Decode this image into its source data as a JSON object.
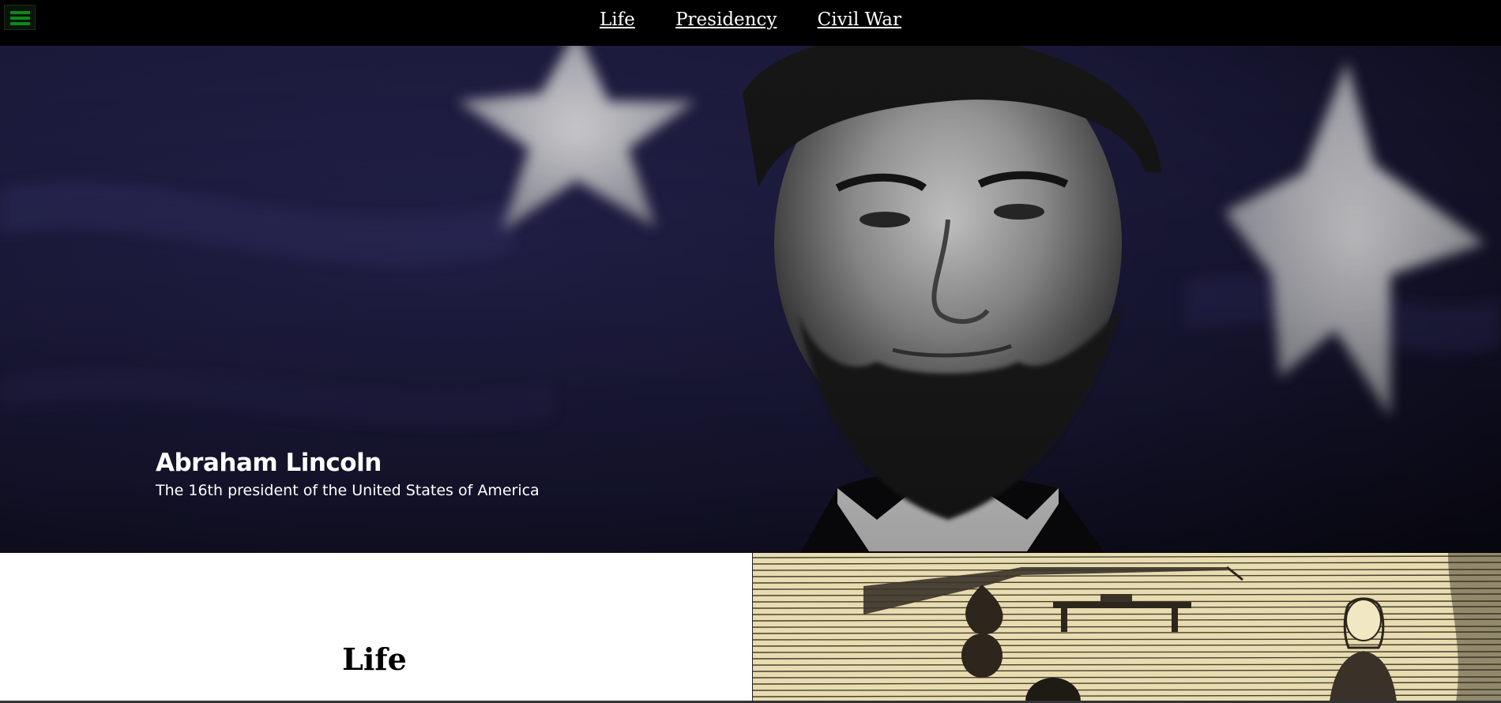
{
  "menu": {
    "icon": "hamburger-menu-icon"
  },
  "nav": {
    "items": [
      "Life",
      "Presidency",
      "Civil War"
    ]
  },
  "hero": {
    "title": "Abraham Lincoln",
    "subtitle": "The 16th president of the United States of America",
    "image_description_icon": "portrait-photo"
  },
  "section": {
    "title": "Life",
    "image_icon": "woodcut-illustration"
  },
  "colors": {
    "topbar": "#000000",
    "menu_icon": "#0b8a16",
    "hero_flag": "#1c1a40",
    "woodcut_paper": "#e8dcb0"
  }
}
